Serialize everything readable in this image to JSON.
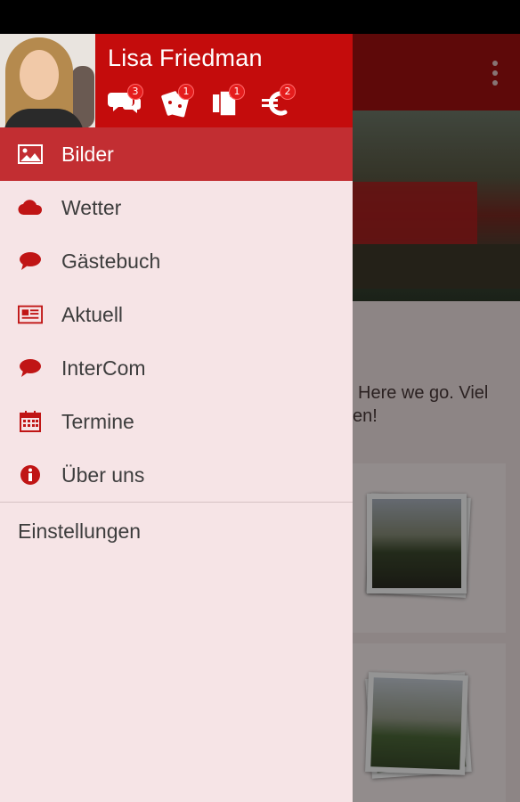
{
  "profile": {
    "name": "Lisa Friedman",
    "badges": [
      {
        "icon": "chat-bubbles-icon",
        "count": "3"
      },
      {
        "icon": "tickets-icon",
        "count": "1"
      },
      {
        "icon": "documents-icon",
        "count": "1"
      },
      {
        "icon": "euro-icon",
        "count": "2"
      }
    ]
  },
  "menu": {
    "items": [
      {
        "icon": "image-icon",
        "label": "Bilder",
        "active": true
      },
      {
        "icon": "cloud-icon",
        "label": "Wetter"
      },
      {
        "icon": "speech-bubble-icon",
        "label": "Gästebuch"
      },
      {
        "icon": "newspaper-icon",
        "label": "Aktuell"
      },
      {
        "icon": "speech-bubble-icon",
        "label": "InterCom"
      },
      {
        "icon": "calendar-icon",
        "label": "Termine"
      },
      {
        "icon": "info-icon",
        "label": "Über uns"
      }
    ],
    "settings_label": "Einstellungen"
  },
  "background": {
    "post_text_line1": "Here we go. Viel",
    "post_text_line2": "en!"
  },
  "colors": {
    "brand_red": "#c40c0c",
    "active_item": "#c22e32",
    "drawer_bg": "#f6e4e6",
    "icon_red": "#c01515"
  }
}
